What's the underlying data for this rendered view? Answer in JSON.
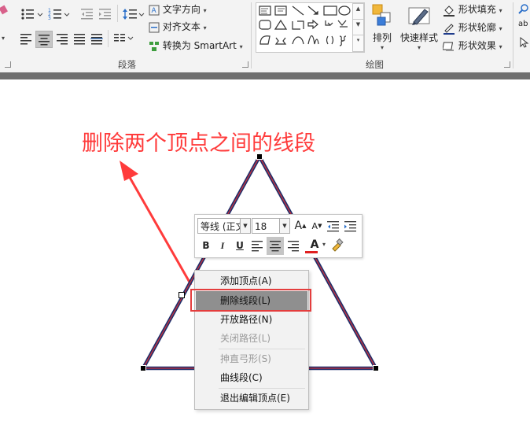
{
  "ribbon": {
    "paragraph": {
      "group_label": "段落",
      "text_direction": "文字方向",
      "align_text": "对齐文本",
      "convert_smartart": "转换为 SmartArt"
    },
    "drawing": {
      "group_label": "绘图",
      "arrange": "排列",
      "quick_styles": "快速样式",
      "shape_fill": "形状填充",
      "shape_outline": "形状轮廓",
      "shape_effects": "形状效果"
    },
    "partial_right": "ab"
  },
  "annotation": {
    "text": "删除两个顶点之间的线段",
    "color": "#ff3b3b"
  },
  "mini_toolbar": {
    "font_name": "等线 (正文",
    "font_size": "18",
    "bold": "B",
    "italic": "I",
    "underline": "U",
    "font_color_letter": "A",
    "grow_font": "A",
    "shrink_font": "A"
  },
  "context_menu": {
    "items": [
      {
        "label": "添加顶点(A)",
        "enabled": true
      },
      {
        "label": "删除线段(L)",
        "enabled": true,
        "highlighted": true
      },
      {
        "label": "开放路径(N)",
        "enabled": true
      },
      {
        "label": "关闭路径(L)",
        "enabled": false
      },
      {
        "label": "抻直弓形(S)",
        "enabled": false
      },
      {
        "label": "曲线段(C)",
        "enabled": true
      },
      {
        "label": "退出编辑顶点(E)",
        "enabled": true
      }
    ]
  },
  "colors": {
    "triangle_outline": "#1f2f6b",
    "triangle_inner": "#c8323c",
    "highlight_box": "#e43d3d",
    "font_color_bar": "#e02020"
  }
}
